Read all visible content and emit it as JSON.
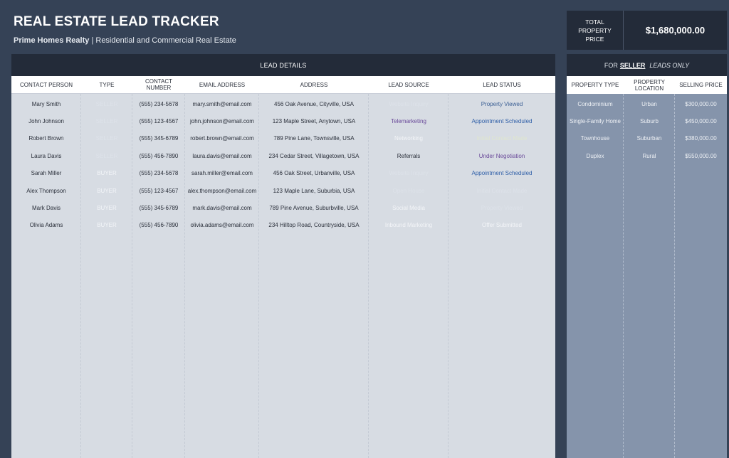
{
  "header": {
    "title": "REAL ESTATE LEAD TRACKER",
    "company": "Prime Homes Realty",
    "separator": "|",
    "tagline": "Residential and Commercial Real Estate"
  },
  "total": {
    "label": "TOTAL PROPERTY PRICE",
    "value": "$1,680,000.00"
  },
  "lead_details": {
    "title": "LEAD DETAILS",
    "columns": [
      "CONTACT PERSON",
      "TYPE",
      "CONTACT NUMBER",
      "EMAIL ADDRESS",
      "ADDRESS",
      "LEAD SOURCE",
      "LEAD STATUS"
    ],
    "rows": [
      {
        "contact": "Mary Smith",
        "type": "SELLER",
        "phone": "(555) 234-5678",
        "email": "mary.smith@email.com",
        "address": "456 Oak Avenue, Cityville, USA",
        "source": "Website Inquiry",
        "status": "Property Viewed"
      },
      {
        "contact": "John Johnson",
        "type": "SELLER",
        "phone": "(555) 123-4567",
        "email": "john.johnson@email.com",
        "address": "123 Maple Street, Anytown, USA",
        "source": "Telemarketing",
        "status": "Appointment Scheduled"
      },
      {
        "contact": "Robert Brown",
        "type": "SELLER",
        "phone": "(555) 345-6789",
        "email": "robert.brown@email.com",
        "address": "789 Pine Lane, Townsville, USA",
        "source": "Networking",
        "status": "Initial Contact Made"
      },
      {
        "contact": "Laura Davis",
        "type": "SELLER",
        "phone": "(555) 456-7890",
        "email": "laura.davis@email.com",
        "address": "234 Cedar Street, Villagetown, USA",
        "source": "Referrals",
        "status": "Under Negotiation"
      },
      {
        "contact": "Sarah Miller",
        "type": "BUYER",
        "phone": "(555) 234-5678",
        "email": "sarah.miller@email.com",
        "address": "456 Oak Street, Urbanville, USA",
        "source": "Website Inquiry",
        "status": "Appointment Scheduled"
      },
      {
        "contact": "Alex Thompson",
        "type": "BUYER",
        "phone": "(555) 123-4567",
        "email": "alex.thompson@email.com",
        "address": "123 Maple Lane, Suburbia, USA",
        "source": "Open House",
        "status": "Initial Contact Made"
      },
      {
        "contact": "Mark Davis",
        "type": "BUYER",
        "phone": "(555) 345-6789",
        "email": "mark.davis@email.com",
        "address": "789 Pine Avenue, Suburbville, USA",
        "source": "Social Media",
        "status": "Property Viewed"
      },
      {
        "contact": "Olivia Adams",
        "type": "BUYER",
        "phone": "(555) 456-7890",
        "email": "olivia.adams@email.com",
        "address": "234 Hilltop Road, Countryside, USA",
        "source": "Inbound Marketing",
        "status": "Offer Submitted"
      }
    ]
  },
  "seller_leads": {
    "title_prefix": "FOR",
    "title_emphasis": "SELLER",
    "title_suffix": "LEADS ONLY",
    "columns": [
      "PROPERTY TYPE",
      "PROPERTY LOCATION",
      "SELLING PRICE"
    ],
    "rows": [
      {
        "type": "Condominium",
        "location": "Urban",
        "price": "$300,000.00"
      },
      {
        "type": "Single-Family Home",
        "location": "Suburb",
        "price": "$450,000.00"
      },
      {
        "type": "Townhouse",
        "location": "Suburban",
        "price": "$380,000.00"
      },
      {
        "type": "Duplex",
        "location": "Rural",
        "price": "$550,000.00"
      }
    ]
  },
  "colors": {
    "page_bg": "#354256",
    "header_bar": "#232b39",
    "lead_panel_bg": "#d7dce3",
    "seller_panel_bg": "#8594ab",
    "telemarketing_text": "#6a4a9a",
    "scheduled_text": "#2f5fa8"
  }
}
